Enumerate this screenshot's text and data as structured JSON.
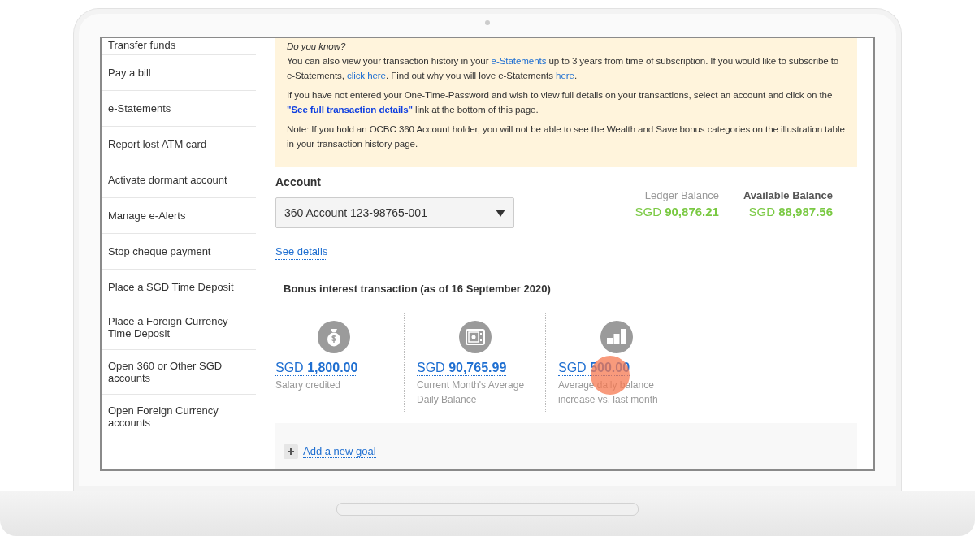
{
  "sidebar": {
    "items": [
      {
        "label": "Transfer funds"
      },
      {
        "label": "Pay a bill"
      },
      {
        "label": "e-Statements"
      },
      {
        "label": "Report lost ATM card"
      },
      {
        "label": "Activate dormant account"
      },
      {
        "label": "Manage e-Alerts"
      },
      {
        "label": "Stop cheque payment"
      },
      {
        "label": "Place a SGD Time Deposit"
      },
      {
        "label": "Place a Foreign Currency Time Deposit"
      },
      {
        "label": "Open 360 or Other SGD accounts"
      },
      {
        "label": "Open Foreign Currency accounts"
      }
    ]
  },
  "notice": {
    "title": "Do you know?",
    "paragraphs": [
      [
        {
          "kind": "text",
          "text": "You can also view your transaction history in your "
        },
        {
          "kind": "link",
          "text": "e-Statements"
        },
        {
          "kind": "text",
          "text": " up to 3 years from time of subscription. If you would like to subscribe to e-Statements, "
        },
        {
          "kind": "link",
          "text": "click here"
        },
        {
          "kind": "text",
          "text": ". Find out why you will love e-Statements "
        },
        {
          "kind": "link",
          "text": "here"
        },
        {
          "kind": "text",
          "text": "."
        }
      ],
      [
        {
          "kind": "text",
          "text": "If you have not entered your One-Time-Password and wish to view full details on your transactions, select an account and click on the "
        },
        {
          "kind": "strong-link",
          "text": "\"See full transaction details\""
        },
        {
          "kind": "text",
          "text": " link at the bottom of this page."
        }
      ],
      [
        {
          "kind": "text",
          "text": "Note: If you hold an OCBC 360 Account holder, you will not be able to see the Wealth and Save bonus categories on the illustration table in your transaction history page."
        }
      ]
    ]
  },
  "account": {
    "label": "Account",
    "selected_account": "360 Account 123-98765-001",
    "details_link": "See details"
  },
  "balances": [
    {
      "label": "Ledger Balance",
      "amount": "SGD **90,876.21**",
      "label_bold": false
    },
    {
      "label": "Available Balance",
      "amount": "SGD **88,987.56**",
      "label_bold": true
    }
  ],
  "bonus": {
    "title": "Bonus interest transaction (as of 16 September 2020)",
    "items": [
      {
        "kind": "money-bag",
        "amount": "SGD **1,800.00**",
        "caption": "Salary credited"
      },
      {
        "kind": "safe",
        "amount": "SGD **90,765.99**",
        "caption": "Current Month's Average Daily Balance"
      },
      {
        "kind": "growth",
        "amount": "SGD **500.00**",
        "caption": "Average daily balance increase vs. last month"
      }
    ]
  },
  "goal": {
    "label": "Add a new goal"
  }
}
